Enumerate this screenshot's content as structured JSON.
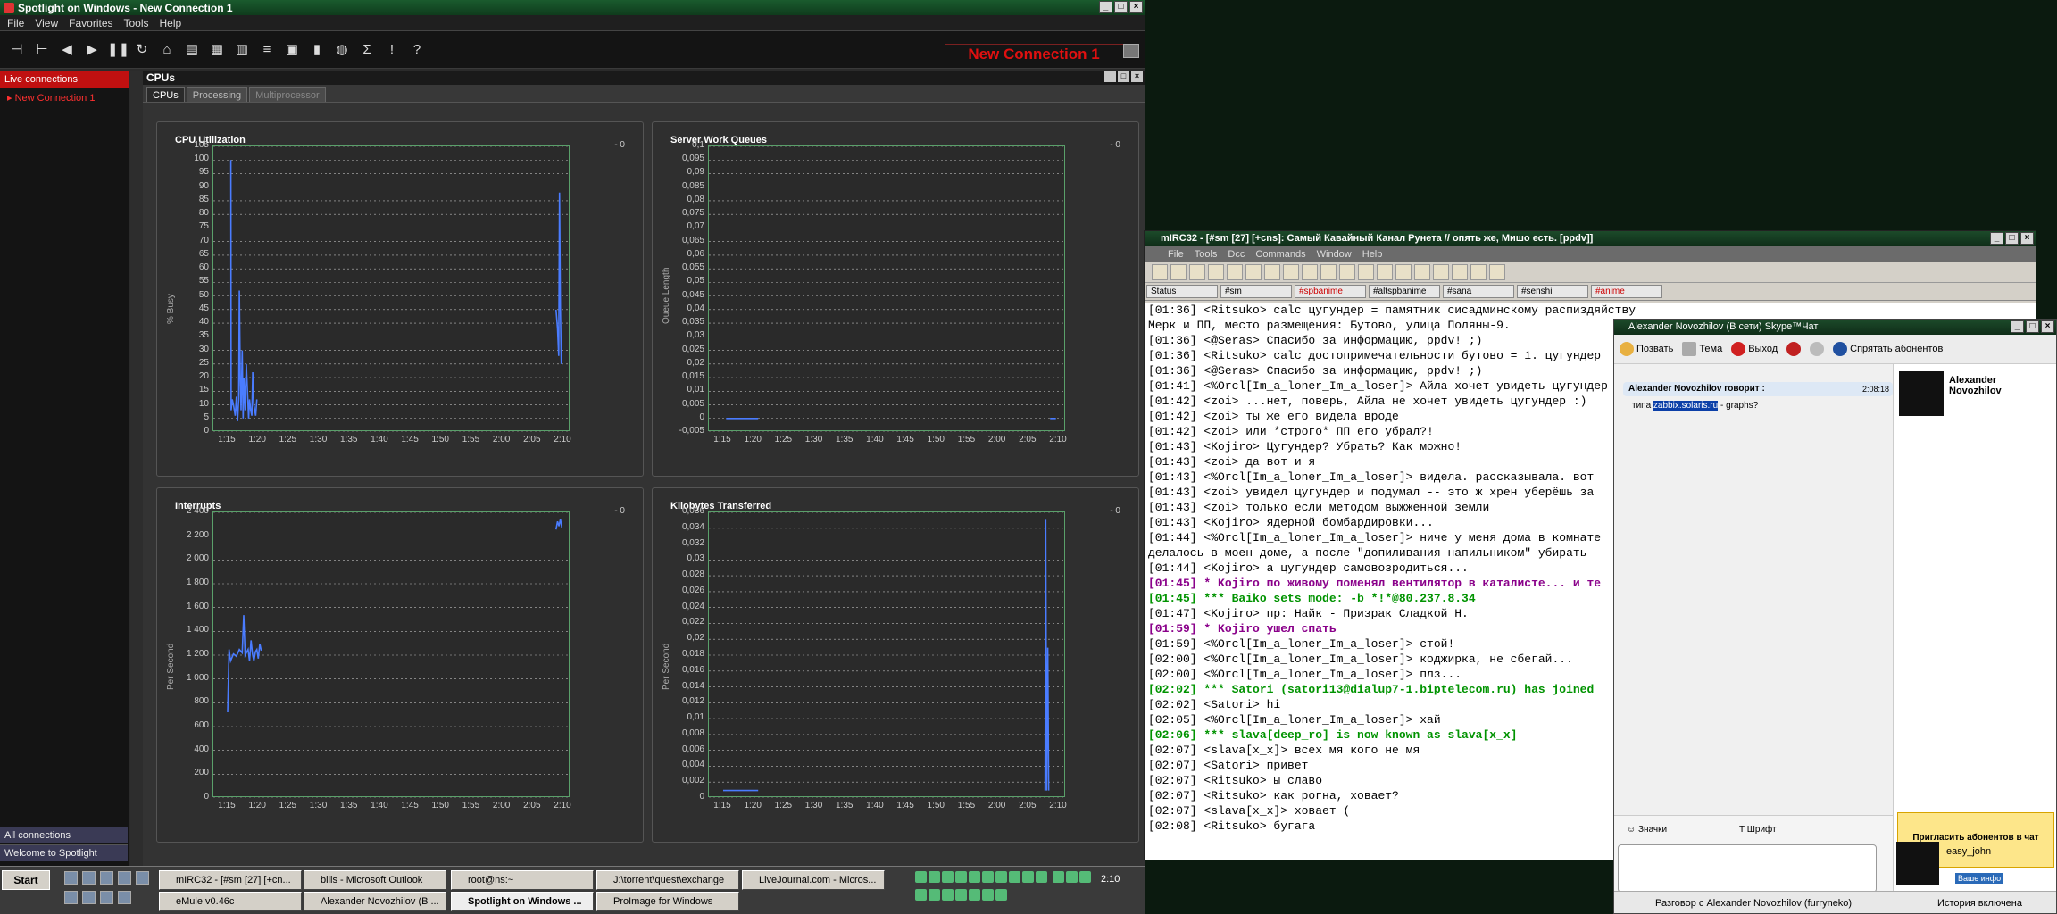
{
  "spotlight": {
    "title": "Spotlight on Windows - New Connection 1",
    "menu": [
      "File",
      "View",
      "Favorites",
      "Tools",
      "Help"
    ],
    "connection_name": "New Connection 1",
    "left": {
      "header": "Live connections",
      "item": "New Connection 1",
      "all_connections": "All connections",
      "welcome": "Welcome to Spotlight"
    },
    "panel_title": "CPUs",
    "tabs": [
      "CPUs",
      "Processing",
      "Multiprocessor"
    ],
    "charts": [
      {
        "title": "CPU Utilization",
        "ylabel": "% Busy",
        "current": "0"
      },
      {
        "title": "Server Work Queues",
        "ylabel": "Queue Length",
        "current": "0"
      },
      {
        "title": "Interrupts",
        "ylabel": "Per Second",
        "current": "0"
      },
      {
        "title": "Kilobytes Transferred",
        "ylabel": "Per Second",
        "current": "0"
      }
    ]
  },
  "chart_data": [
    {
      "type": "line",
      "title": "CPU Utilization",
      "ylabel": "% Busy",
      "ylim": [
        0,
        105
      ],
      "yticks": [
        "105",
        "100",
        "95",
        "90",
        "85",
        "80",
        "75",
        "70",
        "65",
        "60",
        "55",
        "50",
        "45",
        "40",
        "35",
        "30",
        "25",
        "20",
        "15",
        "10",
        "5",
        "0"
      ],
      "xticks": [
        "1:15",
        "1:20",
        "1:25",
        "1:30",
        "1:35",
        "1:40",
        "1:45",
        "1:50",
        "1:55",
        "2:00",
        "2:05",
        "2:10"
      ],
      "series": [
        {
          "values": [
            [
              1.1,
              100
            ],
            [
              1.2,
              8
            ],
            [
              1.6,
              12
            ],
            [
              2,
              10
            ],
            [
              2.6,
              6
            ],
            [
              3,
              13
            ],
            [
              3.4,
              4
            ],
            [
              3.8,
              12
            ],
            [
              4,
              52
            ],
            [
              4.3,
              20
            ],
            [
              4.6,
              8
            ],
            [
              5,
              30
            ],
            [
              5.3,
              5
            ],
            [
              5.6,
              20
            ],
            [
              6,
              8
            ],
            [
              6.4,
              25
            ],
            [
              6.8,
              15
            ],
            [
              7.2,
              5
            ],
            [
              7.5,
              12
            ],
            [
              7.9,
              8
            ],
            [
              8.3,
              6
            ],
            [
              8.6,
              22
            ],
            [
              9,
              10
            ],
            [
              9.6,
              6
            ],
            [
              10,
              12
            ],
            [
              112.5,
              45
            ],
            [
              113,
              38
            ],
            [
              113.4,
              28
            ],
            [
              113.7,
              88
            ],
            [
              114,
              45
            ],
            [
              114.3,
              25
            ]
          ]
        }
      ]
    },
    {
      "type": "line",
      "title": "Server Work Queues",
      "ylabel": "Queue Length",
      "ylim": [
        -0.005,
        0.1
      ],
      "yticks": [
        "0,1",
        "0,095",
        "0,09",
        "0,085",
        "0,08",
        "0,075",
        "0,07",
        "0,065",
        "0,06",
        "0,055",
        "0,05",
        "0,045",
        "0,04",
        "0,035",
        "0,03",
        "0,025",
        "0,02",
        "0,015",
        "0,01",
        "0,005",
        "0",
        "-0,005"
      ],
      "xticks": [
        "1:15",
        "1:20",
        "1:25",
        "1:30",
        "1:35",
        "1:40",
        "1:45",
        "1:50",
        "1:55",
        "2:00",
        "2:05",
        "2:10"
      ],
      "series": [
        {
          "values": [
            [
              1,
              0
            ],
            [
              12,
              0
            ],
            [
              112,
              0
            ],
            [
              114,
              0
            ]
          ]
        }
      ]
    },
    {
      "type": "line",
      "title": "Interrupts",
      "ylabel": "Per Second",
      "ylim": [
        0,
        2500
      ],
      "yticks": [
        "2 400",
        "2 200",
        "2 000",
        "1 800",
        "1 600",
        "1 400",
        "1 200",
        "1 000",
        "800",
        "600",
        "400",
        "200",
        "0"
      ],
      "xticks": [
        "1:15",
        "1:20",
        "1:25",
        "1:30",
        "1:35",
        "1:40",
        "1:45",
        "1:50",
        "1:55",
        "2:00",
        "2:05",
        "2:10"
      ],
      "series": [
        {
          "values": [
            [
              0,
              750
            ],
            [
              0.5,
              1300
            ],
            [
              1,
              1200
            ],
            [
              2,
              1260
            ],
            [
              3,
              1240
            ],
            [
              4,
              1300
            ],
            [
              5,
              1270
            ],
            [
              5.5,
              1600
            ],
            [
              6,
              1250
            ],
            [
              7,
              1300
            ],
            [
              7.5,
              1200
            ],
            [
              8,
              1380
            ],
            [
              8.5,
              1260
            ],
            [
              9,
              1200
            ],
            [
              9.5,
              1280
            ],
            [
              10,
              1300
            ],
            [
              10.5,
              1220
            ],
            [
              11,
              1350
            ],
            [
              11.5,
              1290
            ],
            [
              112.5,
              2350
            ],
            [
              113,
              2420
            ],
            [
              113.5,
              2380
            ],
            [
              114,
              2440
            ],
            [
              114.5,
              2360
            ]
          ]
        }
      ]
    },
    {
      "type": "line",
      "title": "Kilobytes Transferred",
      "ylabel": "Per Second",
      "ylim": [
        -0.001,
        0.037
      ],
      "yticks": [
        "0,036",
        "0,034",
        "0,032",
        "0,03",
        "0,028",
        "0,026",
        "0,024",
        "0,022",
        "0,02",
        "0,018",
        "0,016",
        "0,014",
        "0,012",
        "0,01",
        "0,008",
        "0,006",
        "0,004",
        "0,002",
        "0"
      ],
      "xticks": [
        "1:15",
        "1:20",
        "1:25",
        "1:30",
        "1:35",
        "1:40",
        "1:45",
        "1:50",
        "1:55",
        "2:00",
        "2:05",
        "2:10"
      ],
      "series": [
        {
          "values": [
            [
              0,
              0
            ],
            [
              12,
              0
            ],
            [
              110.3,
              0
            ],
            [
              110.5,
              0.036
            ],
            [
              110.8,
              0
            ],
            [
              111.2,
              0.019
            ],
            [
              111.5,
              0
            ]
          ]
        }
      ]
    }
  ],
  "mirc": {
    "title": "mIRC32 - [#sm [27] [+cns]: Самый Кавайный Канал Рунета // опять же, Мишо есть. [ppdv]]",
    "menu": [
      "File",
      "Tools",
      "Dcc",
      "Commands",
      "Window",
      "Help"
    ],
    "switchbar": [
      {
        "label": "Status",
        "hl": false
      },
      {
        "label": "#sm",
        "hl": false
      },
      {
        "label": "#spbanime",
        "hl": true
      },
      {
        "label": "#altspbanime",
        "hl": false
      },
      {
        "label": "#sana",
        "hl": false
      },
      {
        "label": "#senshi",
        "hl": false
      },
      {
        "label": "#anime",
        "hl": true
      }
    ],
    "lines": [
      {
        "t": "[01:36] <Ritsuko> calc цугундер = памятник сисадминскому распиздяйству",
        "c": ""
      },
      {
        "t": "  Мерк и ПП, место размещения: Бутово, улица Поляны-9.",
        "c": ""
      },
      {
        "t": "[01:36] <@Seras> Спасибо за информацию, ppdv! ;)",
        "c": ""
      },
      {
        "t": "[01:36] <Ritsuko> calc достопримечательности бутово = 1. цугундер",
        "c": ""
      },
      {
        "t": "[01:36] <@Seras> Спасибо за информацию, ppdv! ;)",
        "c": ""
      },
      {
        "t": "[01:41] <%Orcl[Im_a_loner_Im_a_loser]> Айла хочет увидеть цугундер",
        "c": ""
      },
      {
        "t": "[01:42] <zoi> ...нет, поверь, Айла не хочет увидеть цугундер :)",
        "c": ""
      },
      {
        "t": "[01:42] <zoi> ты же его видела вроде",
        "c": ""
      },
      {
        "t": "[01:42] <zoi> или *строго* ПП его убрал?!",
        "c": ""
      },
      {
        "t": "[01:43] <Kojiro> Цугундер? Убрать? Как можно!",
        "c": ""
      },
      {
        "t": "[01:43] <zoi> да вот и я",
        "c": ""
      },
      {
        "t": "[01:43] <%Orcl[Im_a_loner_Im_a_loser]> видела. рассказывала. вот",
        "c": ""
      },
      {
        "t": "[01:43] <zoi> увидел цугундер и подумал -- это ж хрен уберёшь за",
        "c": ""
      },
      {
        "t": "[01:43] <zoi> только если методом выжженной земли",
        "c": ""
      },
      {
        "t": "[01:43] <Kojiro> ядерной бомбардировки...",
        "c": ""
      },
      {
        "t": "[01:44] <%Orcl[Im_a_loner_Im_a_loser]> ниче у меня дома в комнате",
        "c": ""
      },
      {
        "t": "  делалось в моен доме, а после \"допиливания напильником\" убирать",
        "c": ""
      },
      {
        "t": "[01:44] <Kojiro> а цугундер самовозродиться...",
        "c": ""
      },
      {
        "t": "[01:45] * Kojiro по живому поменял вентилятор в каталисте... и те",
        "c": "pur"
      },
      {
        "t": "[01:45] *** Baiko sets mode: -b *!*@80.237.8.34",
        "c": "grn"
      },
      {
        "t": "[01:47] <Kojiro> пр: Найк - Призрак Сладкой Н.",
        "c": ""
      },
      {
        "t": "[01:59] * Kojiro ушел спать",
        "c": "pur"
      },
      {
        "t": "[01:59] <%Orcl[Im_a_loner_Im_a_loser]> стой!",
        "c": ""
      },
      {
        "t": "[02:00] <%Orcl[Im_a_loner_Im_a_loser]> коджирка, не сбегай...",
        "c": ""
      },
      {
        "t": "[02:00] <%Orcl[Im_a_loner_Im_a_loser]> плз...",
        "c": ""
      },
      {
        "t": "[02:02] *** Satori (satori13@dialup7-1.biptelecom.ru) has joined",
        "c": "grn"
      },
      {
        "t": "[02:02] <Satori> hi",
        "c": ""
      },
      {
        "t": "[02:05] <%Orcl[Im_a_loner_Im_a_loser]> хай",
        "c": ""
      },
      {
        "t": "[02:06] *** slava[deep_ro] is now known as slava[x_x]",
        "c": "grn"
      },
      {
        "t": "[02:07] <slava[x_x]> всех мя кого не мя",
        "c": ""
      },
      {
        "t": "[02:07] <Satori> привет",
        "c": ""
      },
      {
        "t": "[02:07] <Ritsuko> ы славо",
        "c": ""
      },
      {
        "t": "[02:07] <Ritsuko> как рогна, ховает?",
        "c": ""
      },
      {
        "t": "[02:07] <slava[x_x]> ховает (",
        "c": ""
      },
      {
        "t": "[02:08] <Ritsuko> бугага",
        "c": ""
      }
    ]
  },
  "skype": {
    "title": "Alexander Novozhilov (В сети) Skype™Чат",
    "toolbar": [
      "Позвать",
      "Тема",
      "Выход",
      "Спрятать абонентов"
    ],
    "msg_header": "Alexander Novozhilov говорит :",
    "msg_time": "2:08:18",
    "msg_pre": "типа ",
    "msg_link": "zabbix.solaris.ru",
    "msg_post": " - graphs?",
    "contact": "Alexander Novozhilov",
    "invite": "Пригласить абонентов в чат",
    "emoticons": "Значки",
    "font": "Шрифт",
    "me": "easy_john",
    "my_info": "Ваше инфо",
    "status": "Разговор с Alexander Novozhilov (furryneko)",
    "status_right": "История включена"
  },
  "taskbar": {
    "start": "Start",
    "buttons": [
      "mIRC32 - [#sm [27] [+cn...",
      "bills - Microsoft Outlook",
      "root@ns:~",
      "J:\\torrent\\quest\\exchange",
      "LiveJournal.com - Micros...",
      "eMule v0.46c",
      "Alexander Novozhilov (В ...",
      "Spotlight on Windows ...",
      "ProImage for Windows"
    ],
    "clock": "2:10"
  }
}
